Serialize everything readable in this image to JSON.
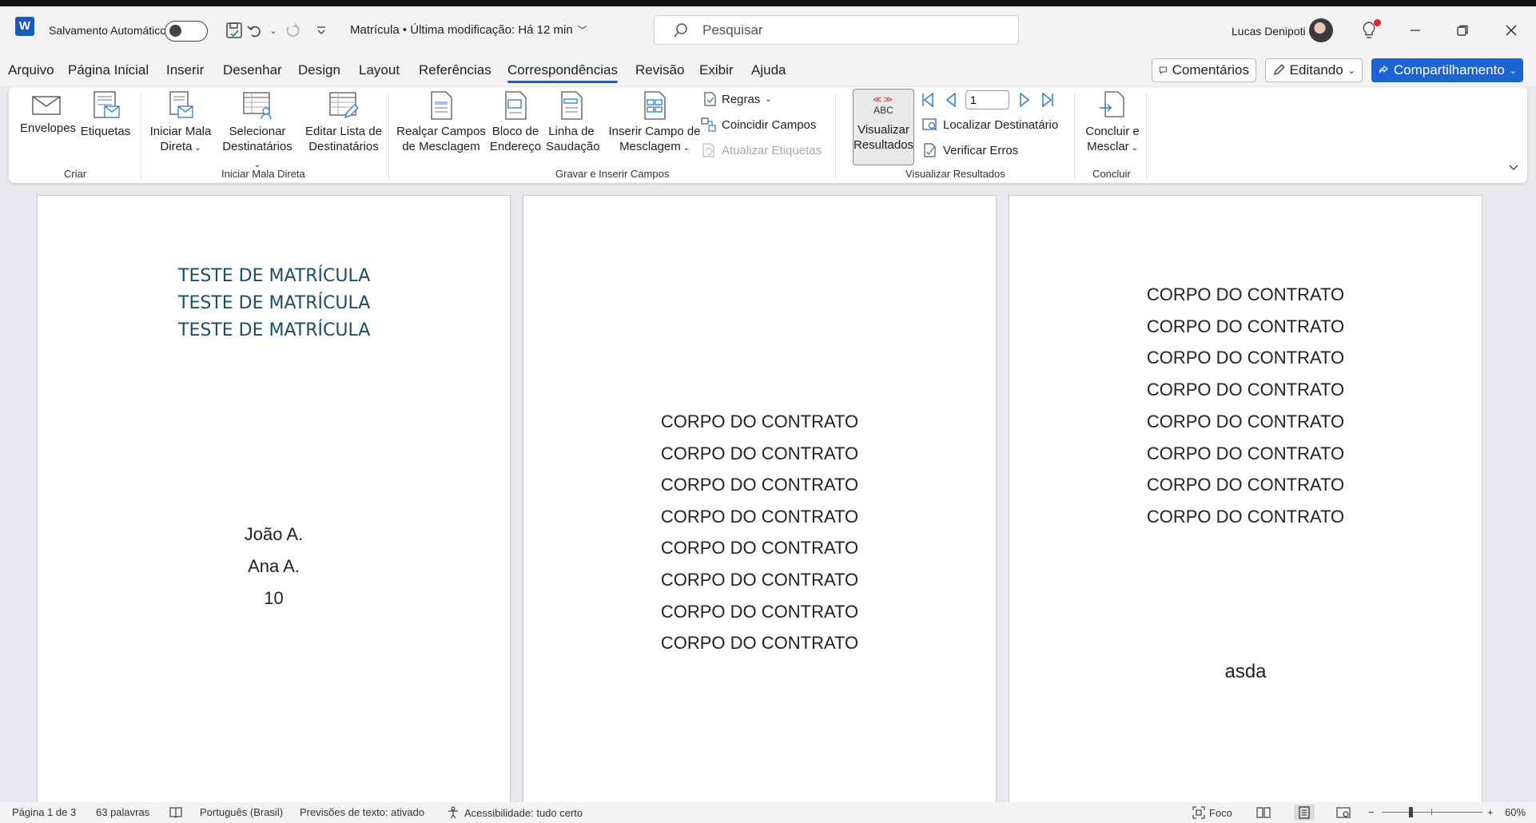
{
  "titlebar": {
    "app_logo": "W",
    "autosave_label": "Salvamento Automático",
    "autosave_state": "off",
    "doc_title": "Matrícula • Última modificação: Há 12 min",
    "search_placeholder": "Pesquisar",
    "user_name": "Lucas Denipoti"
  },
  "menu": {
    "items": [
      "Arquivo",
      "Página Inicial",
      "Inserir",
      "Desenhar",
      "Design",
      "Layout",
      "Referências",
      "Correspondências",
      "Revisão",
      "Exibir",
      "Ajuda"
    ],
    "active": "Correspondências",
    "comments_label": "Comentários",
    "editing_label": "Editando",
    "share_label": "Compartilhamento"
  },
  "ribbon": {
    "envelopes": "Envelopes",
    "labels": "Etiquetas",
    "start_merge_1": "Iniciar Mala",
    "start_merge_2": "Direta",
    "select_recipients_1": "Selecionar",
    "select_recipients_2": "Destinatários",
    "edit_list_1": "Editar Lista de",
    "edit_list_2": "Destinatários",
    "highlight_fields_1": "Realçar Campos",
    "highlight_fields_2": "de Mesclagem",
    "address_block_1": "Bloco de",
    "address_block_2": "Endereço",
    "greeting_line_1": "Linha de",
    "greeting_line_2": "Saudação",
    "insert_field_1": "Inserir Campo de",
    "insert_field_2": "Mesclagem",
    "rules": "Regras",
    "match_fields": "Coincidir Campos",
    "update_labels": "Atualizar Etiquetas",
    "preview_abc": "ABC",
    "preview_1": "Visualizar",
    "preview_2": "Resultados",
    "record_number": "1",
    "find_recipient": "Localizar Destinatário",
    "check_errors": "Verificar Erros",
    "finish_merge_1": "Concluir e",
    "finish_merge_2": "Mesclar",
    "groups": {
      "create": "Criar",
      "start_merge": "Iniciar Mala Direta",
      "write_insert": "Gravar e Inserir Campos",
      "preview": "Visualizar Resultados",
      "finish": "Concluir"
    }
  },
  "document": {
    "page1": {
      "headings": [
        "TESTE DE MATRÍCULA",
        "TESTE DE MATRÍCULA",
        "TESTE DE MATRÍCULA"
      ],
      "fields": [
        "João A.",
        "Ana A.",
        "10"
      ]
    },
    "page2": {
      "lines": [
        "CORPO DO CONTRATO",
        "CORPO DO CONTRATO",
        "CORPO DO CONTRATO",
        "CORPO DO CONTRATO",
        "CORPO DO CONTRATO",
        "CORPO DO CONTRATO",
        "CORPO DO CONTRATO",
        "CORPO DO CONTRATO"
      ]
    },
    "page3": {
      "lines": [
        "CORPO DO CONTRATO",
        "CORPO DO CONTRATO",
        "CORPO DO CONTRATO",
        "CORPO DO CONTRATO",
        "CORPO DO CONTRATO",
        "CORPO DO CONTRATO",
        "CORPO DO CONTRATO",
        "CORPO DO CONTRATO"
      ],
      "footer_text": "asda"
    }
  },
  "status": {
    "page": "Página 1 de 3",
    "words": "63 palavras",
    "language": "Português (Brasil)",
    "text_predictions": "Previsões de texto: ativado",
    "accessibility": "Acessibilidade: tudo certo",
    "focus": "Foco",
    "zoom": "60%"
  },
  "colors": {
    "accent": "#185abd",
    "share_button": "#1b64d1",
    "heading_text": "#1c4d6b",
    "notification": "#e0242e"
  }
}
